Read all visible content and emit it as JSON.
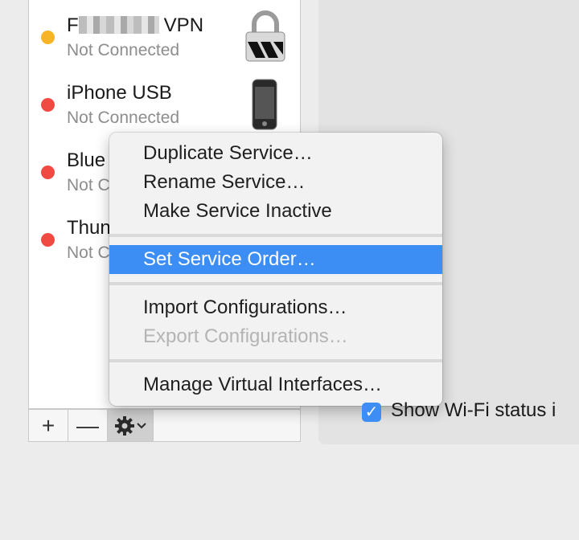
{
  "services": [
    {
      "name_suffix": "VPN",
      "status": "Not Connected",
      "dot_color": "#f6b426",
      "icon": "lock-icon"
    },
    {
      "name": "iPhone USB",
      "status": "Not Connected",
      "dot_color": "#f04a43",
      "icon": "iphone-icon"
    },
    {
      "name": "Blue",
      "status": "Not C",
      "dot_color": "#f04a43"
    },
    {
      "name": "Thun",
      "status": "Not C",
      "dot_color": "#f04a43"
    }
  ],
  "toolbar": {
    "add_label": "+",
    "remove_label": "—",
    "gear_icon": "gear-icon",
    "chevron": "⌄"
  },
  "context_menu": {
    "items": [
      {
        "label": "Duplicate Service…"
      },
      {
        "label": "Rename Service…"
      },
      {
        "label": "Make Service Inactive"
      },
      {
        "label": "Set Service Order…",
        "selected": true
      },
      {
        "label": "Import Configurations…"
      },
      {
        "label": "Export Configurations…",
        "disabled": true
      },
      {
        "label": "Manage Virtual Interfaces…"
      }
    ]
  },
  "wifi_checkbox": {
    "label": "Show Wi-Fi status i",
    "checked": true
  },
  "colors": {
    "accent": "#3d8ef4",
    "status_yellow": "#f6b426",
    "status_red": "#f04a43"
  }
}
